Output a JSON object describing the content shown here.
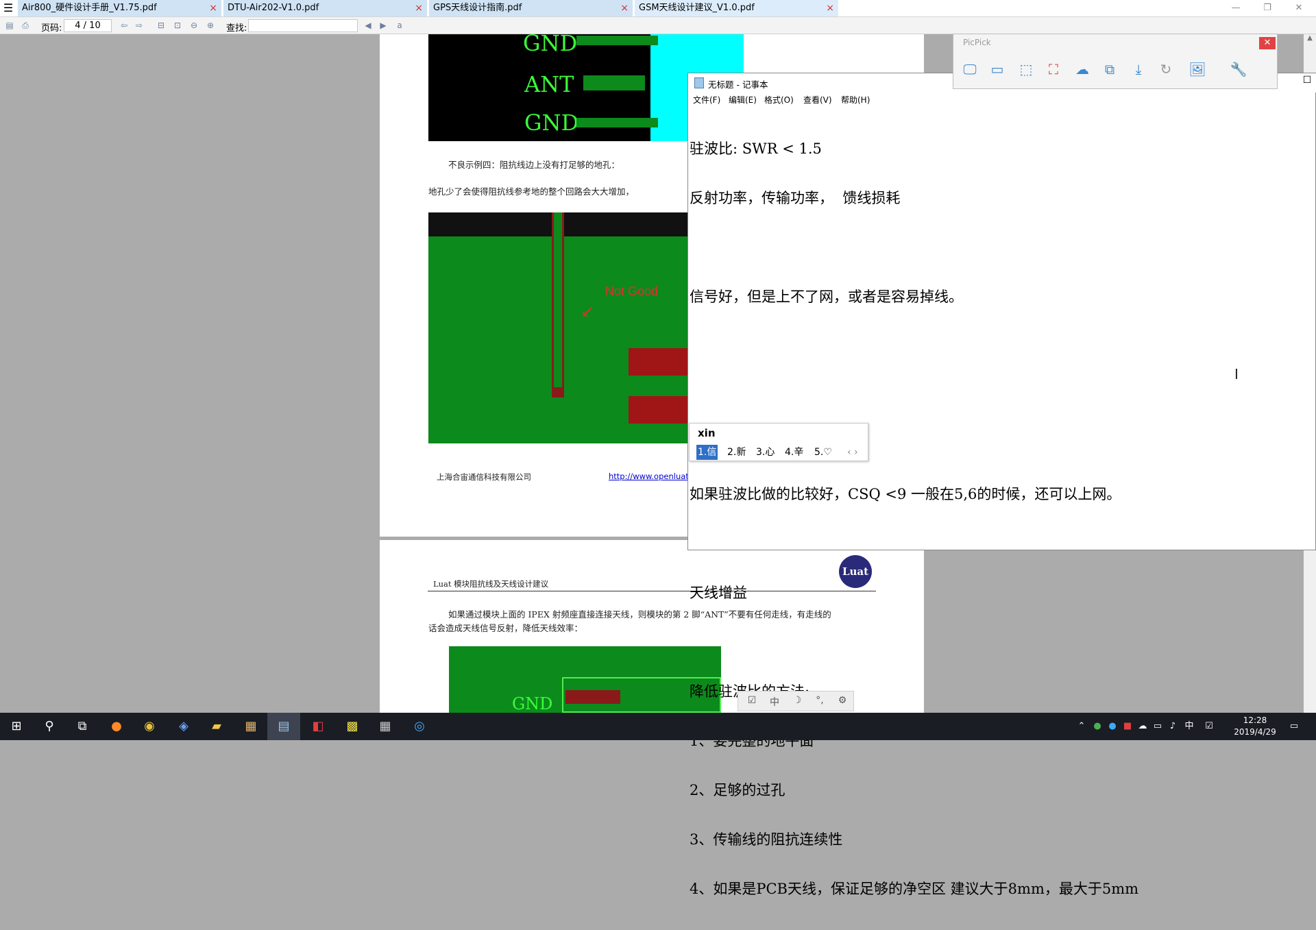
{
  "tabs": [
    {
      "label": "Air800_硬件设计手册_V1.75.pdf",
      "close": "×"
    },
    {
      "label": "DTU-Air202-V1.0.pdf",
      "close": "×"
    },
    {
      "label": "GPS天线设计指南.pdf",
      "close": "×"
    },
    {
      "label": "GSM天线设计建议_V1.0.pdf",
      "close": "×"
    }
  ],
  "toolbar": {
    "page_label": "页码:",
    "page_value": "4 / 10",
    "find_label": "查找:"
  },
  "doc": {
    "gnd1": "GND",
    "ant": "ANT",
    "gnd2": "GND",
    "example4": "不良示例四：阻抗线边上没有打足够的地孔：",
    "para_vias": "地孔少了会使得阻抗线参考地的整个回路会大大增加，强烈建",
    "not_good": "Not Good",
    "company": "上海合宙通信科技有限公司",
    "url": "http://www.openluat.c",
    "header2": "Luat 模块阻抗线及天线设计建议",
    "logo": "Luat",
    "para_ipex_1": "如果通过模块上面的 IPEX 射频座直接连接天线，则模块的第 2 脚“ANT”不要有任何走线，有走线的",
    "para_ipex_2": "话会造成天线信号反射，降低天线效率：",
    "gnd3": "GND"
  },
  "notepad": {
    "title": "无标题 - 记事本",
    "menu": [
      "文件(F)",
      "编辑(E)",
      "格式(O)",
      "查看(V)",
      "帮助(H)"
    ],
    "lines": [
      "驻波比: SWR < 1.5",
      "反射功率，传输功率，  馈线损耗",
      "",
      "信号好，但是上不了网，或者是容易掉线。",
      "",
      "",
      "",
      "如果驻波比做的比较好，CSQ <9 一般在5,6的时候，还可以上网。",
      "",
      "天线增益",
      "",
      "降低驻波比的方法:",
      "1、要完整的地平面",
      "2、足够的过孔",
      "3、传输线的阻抗连续性",
      "4、如果是PCB天线，保证足够的净空区 建议大于8mm，最大于5mm"
    ]
  },
  "ime": {
    "input": "xin",
    "candidates": [
      "1.信",
      "2.新",
      "3.心",
      "4.辛",
      "5.♡"
    ],
    "nav": "‹ ›"
  },
  "picpick": {
    "title": "PicPick",
    "close": "✕",
    "tools": [
      "monitor-icon",
      "window-icon",
      "region-icon",
      "fixed-region-icon",
      "freehand-icon",
      "scroll-window-icon",
      "download-icon",
      "repeat-icon",
      "image-icon",
      "tools-icon"
    ]
  },
  "float_tray": {
    "middle": "中"
  },
  "taskbar": {
    "time": "12:28",
    "date": "2019/4/29",
    "ime_indicator": "中"
  },
  "colors": {
    "pcb_green": "#0c8a1c",
    "tab_bg": "#cfe3f5",
    "not_good_red": "#e03030",
    "ime_selected": "#2e6fc7"
  }
}
